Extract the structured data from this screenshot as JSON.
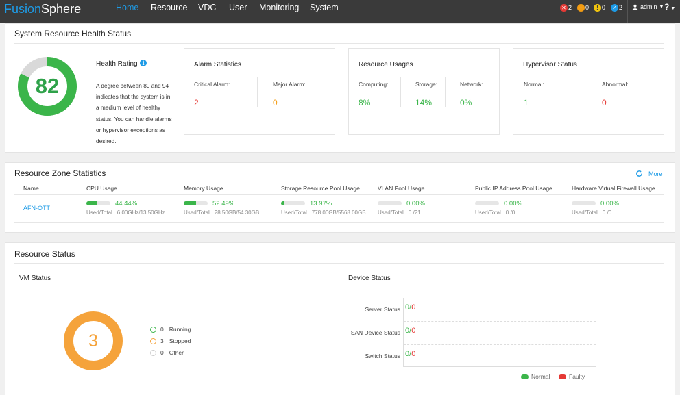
{
  "app": {
    "logo_a": "Fusion",
    "logo_b": "Sphere"
  },
  "nav": [
    "Home",
    "Resource",
    "VDC",
    "User",
    "Monitoring",
    "System"
  ],
  "alerts": {
    "critical": "2",
    "major": "0",
    "minor": "0",
    "info": "2"
  },
  "user": {
    "name": "admin",
    "help": "?"
  },
  "health": {
    "title": "System Resource Health Status",
    "score": "82",
    "score_fraction": 0.82,
    "rating_title": "Health Rating",
    "description": "A degree between 80 and 94 indicates that the system is in a medium level of healthy status. You can handle alarms or hypervisor exceptions as desired.",
    "alarm": {
      "title": "Alarm Statistics",
      "critical_label": "Critical Alarm:",
      "critical": "2",
      "major_label": "Major Alarm:",
      "major": "0"
    },
    "usage": {
      "title": "Resource Usages",
      "computing_label": "Computing:",
      "computing": "8%",
      "storage_label": "Storage:",
      "storage": "14%",
      "network_label": "Network:",
      "network": "0%"
    },
    "hypervisor": {
      "title": "Hypervisor Status",
      "normal_label": "Normal:",
      "normal": "1",
      "abnormal_label": "Abnormal:",
      "abnormal": "0"
    }
  },
  "zone": {
    "title": "Resource Zone Statistics",
    "more": "More",
    "headers": [
      "Name",
      "CPU Usage",
      "Memory Usage",
      "Storage Resource Pool Usage",
      "VLAN Pool Usage",
      "Public IP Address Pool Usage",
      "Hardware Virtual Firewall Usage"
    ],
    "row": {
      "name": "AFN-OTT",
      "used_total_label": "Used/Total",
      "metrics": [
        {
          "pct": "44.44%",
          "fraction": 0.4444,
          "used_total": "6.00GHz/13.50GHz"
        },
        {
          "pct": "52.49%",
          "fraction": 0.5249,
          "used_total": "28.50GB/54.30GB"
        },
        {
          "pct": "13.97%",
          "fraction": 0.1397,
          "used_total": "778.00GB/5568.00GB"
        },
        {
          "pct": "0.00%",
          "fraction": 0,
          "used_total": "0 /21"
        },
        {
          "pct": "0.00%",
          "fraction": 0,
          "used_total": "0 /0"
        },
        {
          "pct": "0.00%",
          "fraction": 0,
          "used_total": "0 /0"
        }
      ]
    }
  },
  "status": {
    "title": "Resource Status",
    "vm_title": "VM Status",
    "vm_total": "3",
    "vm_legend": [
      {
        "count": "0",
        "label": "Running",
        "color": "#3bb54a"
      },
      {
        "count": "3",
        "label": "Stopped",
        "color": "#f5a33b"
      },
      {
        "count": "0",
        "label": "Other",
        "color": "#cccccc"
      }
    ],
    "device_title": "Device Status",
    "devices": [
      {
        "label": "Server Status",
        "normal": "0",
        "slash": "/",
        "faulty": "0"
      },
      {
        "label": "SAN Device Status",
        "normal": "0",
        "slash": "/",
        "faulty": "0"
      },
      {
        "label": "Switch Status",
        "normal": "0",
        "slash": "/",
        "faulty": "0"
      }
    ],
    "device_legend": {
      "normal": "Normal",
      "faulty": "Faulty"
    }
  },
  "colors": {
    "accent": "#1e9be6",
    "good": "#3bb54a",
    "warn": "#f5a33b",
    "bad": "#e53935",
    "topbar": "#3a3a3a"
  }
}
